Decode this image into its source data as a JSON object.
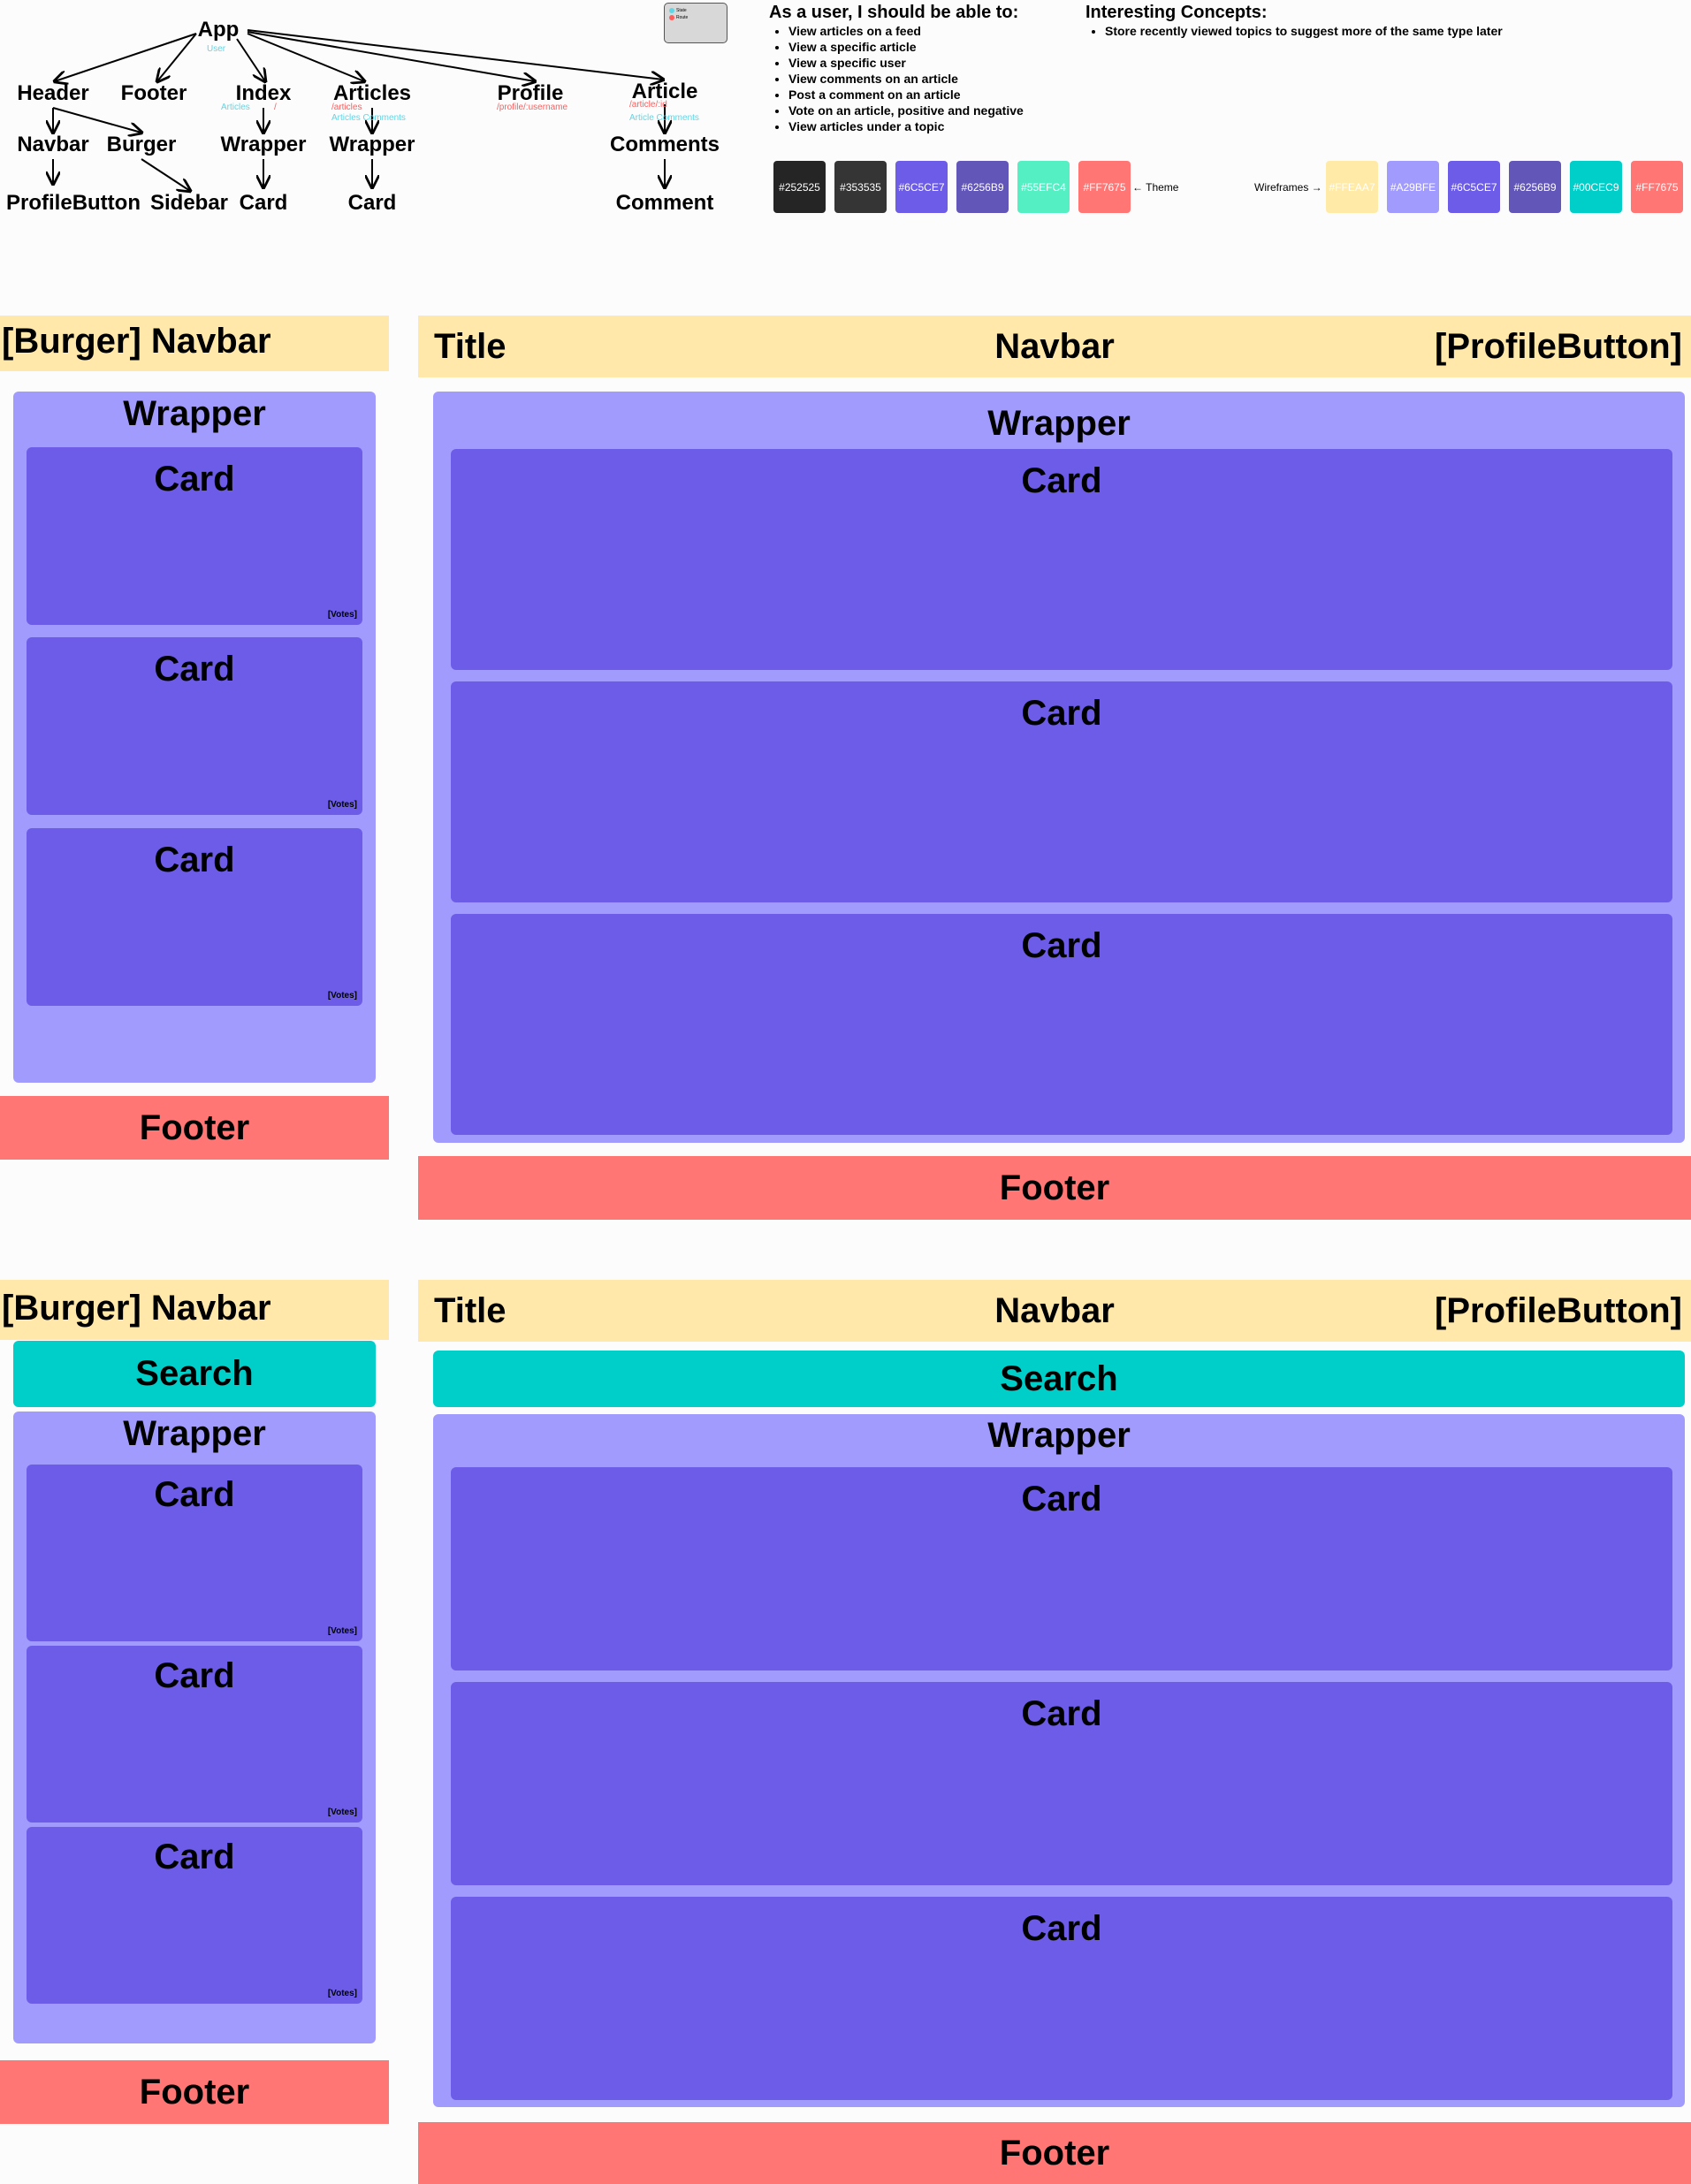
{
  "tree": {
    "nodes": {
      "app": "App",
      "header": "Header",
      "footer": "Footer",
      "index": "Index",
      "articles": "Articles",
      "profile": "Profile",
      "article": "Article",
      "navbar": "Navbar",
      "burger": "Burger",
      "index_wrapper": "Wrapper",
      "articles_wrapper": "Wrapper",
      "comments": "Comments",
      "profile_button": "ProfileButton",
      "sidebar": "Sidebar",
      "index_card": "Card",
      "articles_card": "Card",
      "comment": "Comment"
    },
    "annotations": {
      "app_state": "User",
      "index_state": "Articles",
      "index_route": "/",
      "articles_route": "/articles",
      "articles_state": "Articles   Comments",
      "profile_route": "/profile/:username",
      "article_route": "/article/:id",
      "article_state": "Article   Comments"
    }
  },
  "legend": {
    "state": "State",
    "route": "Route",
    "state_color": "#5fd6e6",
    "route_color": "#ff5c5c"
  },
  "requirements": {
    "title": "As a user, I should be able to:",
    "items": [
      "View articles on a feed",
      "View a specific article",
      "View a specific user",
      "View comments on an article",
      "Post a comment on an article",
      "Vote on an article, positive and negative",
      "View articles under a topic"
    ]
  },
  "concepts": {
    "title": "Interesting Concepts:",
    "items": [
      "Store recently viewed topics to suggest more of the same type later"
    ]
  },
  "theme": {
    "label": "← Theme",
    "colors": [
      "#252525",
      "#353535",
      "#6C5CE7",
      "#6256B9",
      "#55EFC4",
      "#FF7675"
    ]
  },
  "wireframe_palette": {
    "label": "Wireframes →",
    "colors": [
      "#FFEAA7",
      "#A29BFE",
      "#6C5CE7",
      "#6256B9",
      "#00CEC9",
      "#FF7675"
    ]
  },
  "mobile_feed": {
    "navbar": "[Burger] Navbar",
    "wrapper": "Wrapper",
    "cards": [
      "Card",
      "Card",
      "Card"
    ],
    "votes": "[Votes]",
    "footer": "Footer"
  },
  "desktop_feed": {
    "title": "Title",
    "navbar": "Navbar",
    "profile_button": "[ProfileButton]",
    "wrapper": "Wrapper",
    "cards": [
      "Card",
      "Card",
      "Card"
    ],
    "footer": "Footer"
  },
  "mobile_search": {
    "navbar": "[Burger] Navbar",
    "search": "Search",
    "wrapper": "Wrapper",
    "cards": [
      "Card",
      "Card",
      "Card"
    ],
    "votes": "[Votes]",
    "footer": "Footer"
  },
  "desktop_search": {
    "title": "Title",
    "navbar": "Navbar",
    "profile_button": "[ProfileButton]",
    "search": "Search",
    "wrapper": "Wrapper",
    "cards": [
      "Card",
      "Card",
      "Card"
    ],
    "footer": "Footer"
  }
}
